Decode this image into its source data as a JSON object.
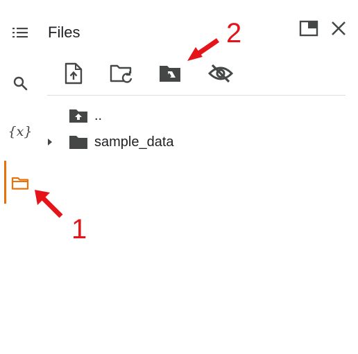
{
  "panel": {
    "title": "Files"
  },
  "rail": {
    "items": [
      {
        "icon": "table-of-contents-icon"
      },
      {
        "icon": "search-icon"
      },
      {
        "icon": "variables-icon",
        "label": "{x}"
      },
      {
        "icon": "folder-icon",
        "active": true
      }
    ]
  },
  "toolbar": {
    "buttons": [
      {
        "icon": "upload-file-icon"
      },
      {
        "icon": "refresh-folder-icon"
      },
      {
        "icon": "mount-drive-icon"
      },
      {
        "icon": "hide-icon"
      }
    ]
  },
  "tree": {
    "items": [
      {
        "label": "..",
        "icon": "parent-folder-icon"
      },
      {
        "label": "sample_data",
        "icon": "folder-icon",
        "expandable": true
      }
    ]
  },
  "annotations": [
    {
      "label": "1"
    },
    {
      "label": "2"
    }
  ],
  "colors": {
    "accent": "#e8710a",
    "annotation": "#e5141b",
    "icon": "#444746",
    "divider": "#dadce0"
  }
}
